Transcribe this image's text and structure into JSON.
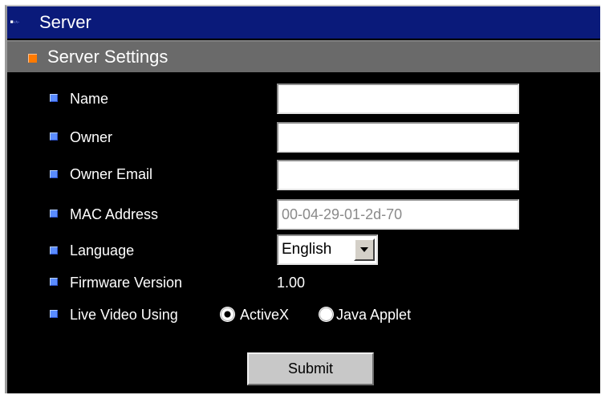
{
  "window": {
    "title": "Server"
  },
  "section": {
    "title": "Server Settings"
  },
  "form": {
    "name": {
      "label": "Name",
      "value": ""
    },
    "owner": {
      "label": "Owner",
      "value": ""
    },
    "owner_email": {
      "label": "Owner Email",
      "value": ""
    },
    "mac_address": {
      "label": "MAC Address",
      "value": "00-04-29-01-2d-70"
    },
    "language": {
      "label": "Language",
      "selected": "English"
    },
    "firmware": {
      "label": "Firmware Version",
      "value": "1.00"
    },
    "live_video": {
      "label": "Live Video Using",
      "options": [
        {
          "label": "ActiveX",
          "checked": true
        },
        {
          "label": "Java Applet",
          "checked": false
        }
      ]
    },
    "submit_label": "Submit"
  },
  "icons": {
    "title": "window-menu-icon",
    "section": "orange-square-icon",
    "bullet": "blue-square-bullet-icon",
    "dropdown": "dropdown-arrow-icon"
  },
  "colors": {
    "title_bar": "#0a1a7a",
    "section_bar": "#6a6a6a",
    "background": "#000000",
    "bullet": "#5a8cff",
    "section_icon": "#ff7a00",
    "text": "#ffffff"
  }
}
